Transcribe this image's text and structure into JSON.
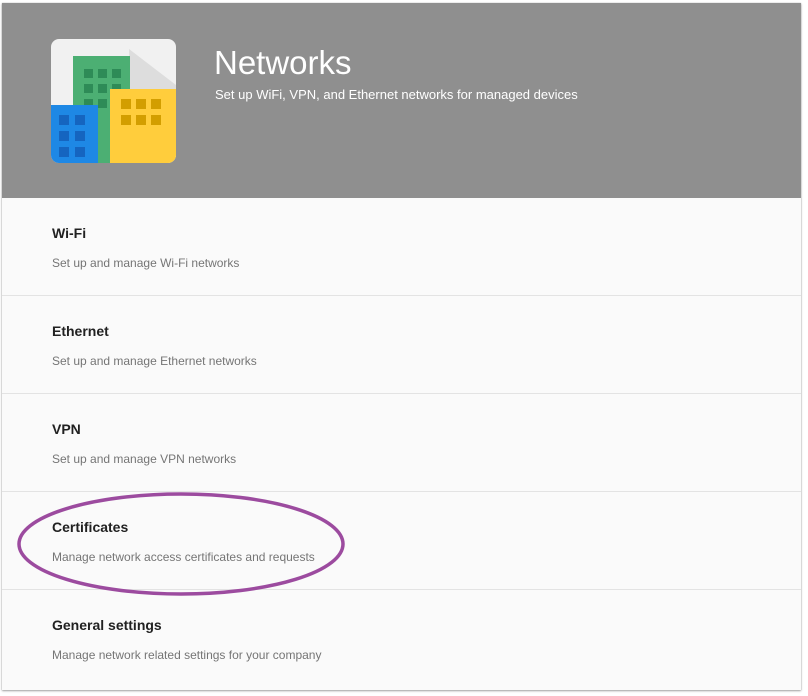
{
  "header": {
    "title": "Networks",
    "subtitle": "Set up WiFi, VPN, and Ethernet networks for managed devices",
    "icon": "buildings-icon",
    "background_color": "#8f8f8f"
  },
  "items": [
    {
      "title": "Wi-Fi",
      "description": "Set up and manage Wi-Fi networks"
    },
    {
      "title": "Ethernet",
      "description": "Set up and manage Ethernet networks"
    },
    {
      "title": "VPN",
      "description": "Set up and manage VPN networks"
    },
    {
      "title": "Certificates",
      "description": "Manage network access certificates and requests"
    },
    {
      "title": "General settings",
      "description": "Manage network related settings for your company"
    }
  ],
  "annotation": {
    "color": "#9c4b9f",
    "target": "Certificates"
  }
}
